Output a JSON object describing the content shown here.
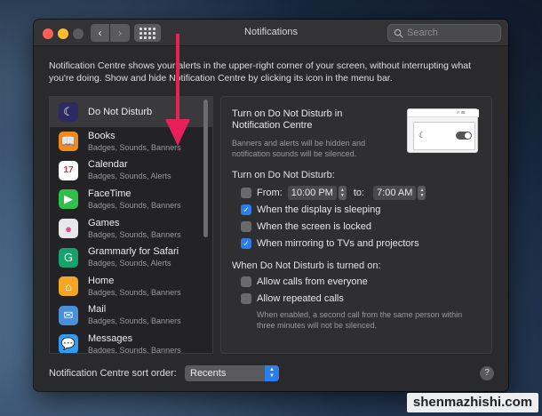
{
  "window": {
    "title": "Notifications"
  },
  "search": {
    "placeholder": "Search"
  },
  "intro_text": "Notification Centre shows your alerts in the upper-right corner of your screen, without interrupting what you're doing. Show and hide Notification Centre by clicking its icon in the menu bar.",
  "apps": [
    {
      "name": "Do Not Disturb",
      "subtitle": "",
      "icon": "moon-icon",
      "color": "#2c2a5e",
      "glyph": "☾"
    },
    {
      "name": "Books",
      "subtitle": "Badges, Sounds, Banners",
      "icon": "books-icon",
      "color": "#f08a1c",
      "glyph": "📖"
    },
    {
      "name": "Calendar",
      "subtitle": "Badges, Sounds, Alerts",
      "icon": "calendar-icon",
      "color": "#ffffff",
      "glyph": "17"
    },
    {
      "name": "FaceTime",
      "subtitle": "Badges, Sounds, Banners",
      "icon": "facetime-icon",
      "color": "#2fbf4a",
      "glyph": "▶"
    },
    {
      "name": "Games",
      "subtitle": "Badges, Sounds, Banners",
      "icon": "games-icon",
      "color": "#e8e8e8",
      "glyph": "●"
    },
    {
      "name": "Grammarly for Safari",
      "subtitle": "Badges, Sounds, Alerts",
      "icon": "grammarly-icon",
      "color": "#15a36b",
      "glyph": "G"
    },
    {
      "name": "Home",
      "subtitle": "Badges, Sounds, Banners",
      "icon": "home-icon",
      "color": "#f5a623",
      "glyph": "⌂"
    },
    {
      "name": "Mail",
      "subtitle": "Badges, Sounds, Banners",
      "icon": "mail-icon",
      "color": "#4a8fd8",
      "glyph": "✉"
    },
    {
      "name": "Messages",
      "subtitle": "Badges, Sounds, Banners",
      "icon": "messages-icon",
      "color": "#2f9df5",
      "glyph": "💬"
    }
  ],
  "dnd": {
    "title": "Turn on Do Not Disturb in Notification Centre",
    "description": "Banners and alerts will be hidden and notification sounds will be silenced.",
    "turn_on_label": "Turn on Do Not Disturb:",
    "from_label": "From:",
    "from_time": "10:00 PM",
    "to_label": "to:",
    "to_time": "7:00 AM",
    "from_checked": false,
    "options": [
      {
        "label": "When the display is sleeping",
        "checked": true
      },
      {
        "label": "When the screen is locked",
        "checked": false
      },
      {
        "label": "When mirroring to TVs and projectors",
        "checked": true
      }
    ],
    "when_on_label": "When Do Not Disturb is turned on:",
    "on_options": [
      {
        "label": "Allow calls from everyone",
        "checked": false
      },
      {
        "label": "Allow repeated calls",
        "checked": false
      }
    ],
    "repeated_note": "When enabled, a second call from the same person within three minutes will not be silenced."
  },
  "sort": {
    "label": "Notification Centre sort order:",
    "value": "Recents"
  },
  "help": "?",
  "watermark": "shenmazhishi.com",
  "accent_color": "#2b7de9",
  "arrow_color": "#e8205a"
}
